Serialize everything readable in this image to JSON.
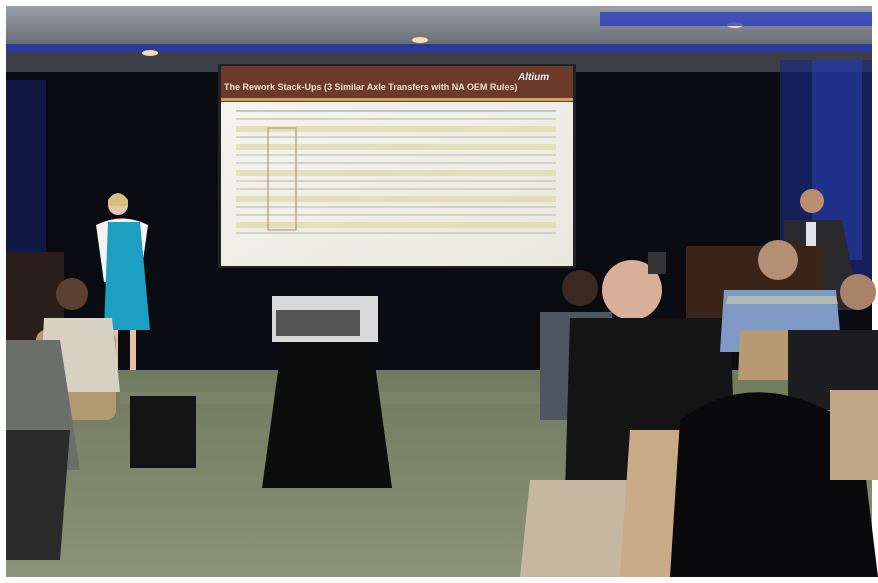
{
  "slide": {
    "title": "The Rework Stack-Ups (3 Similar Axle Transfers with NA OEM Rules)",
    "logo": "Altium"
  },
  "scene": {
    "kind": "conference presentation photograph"
  }
}
